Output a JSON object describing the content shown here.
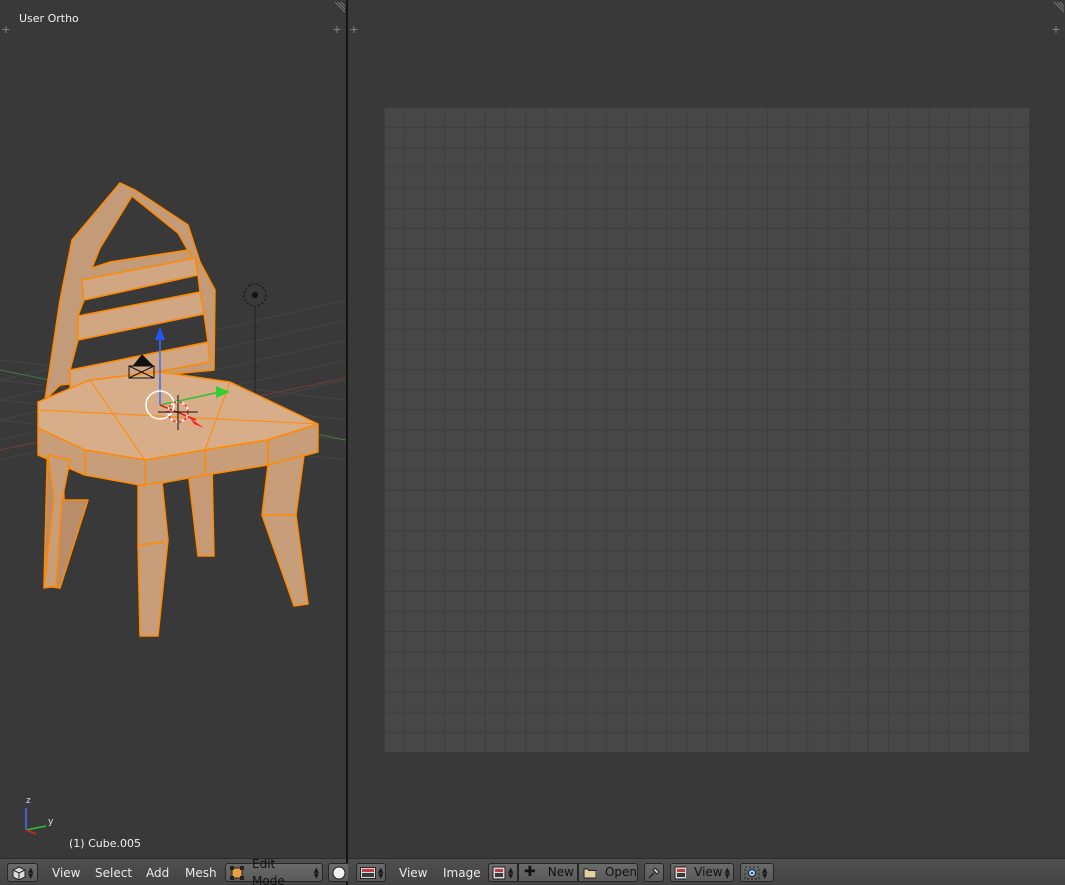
{
  "viewport3d": {
    "title": "User Ortho",
    "object_label": "(1) Cube.005",
    "axes": {
      "z": "z",
      "y": "y"
    }
  },
  "header_left": {
    "editor_type_icon": "cube-icon",
    "menus": [
      "View",
      "Select",
      "Add",
      "Mesh"
    ],
    "mode": "Edit Mode",
    "shading_icon": "sphere-icon"
  },
  "header_right": {
    "editor_type_icon": "image-editor-icon",
    "menus": [
      "View",
      "Image"
    ],
    "image_browse_icon": "image-browse-icon",
    "new_label": "New",
    "open_label": "Open",
    "pin_icon": "pin-icon",
    "view_label": "View",
    "pivot_icon": "pivot-icon"
  },
  "colors": {
    "background": "#393939",
    "mesh_fill": "#c9a07c",
    "mesh_edge": "#ff8a00",
    "uv_grid": "#474747",
    "header": "#4a4a4a"
  }
}
